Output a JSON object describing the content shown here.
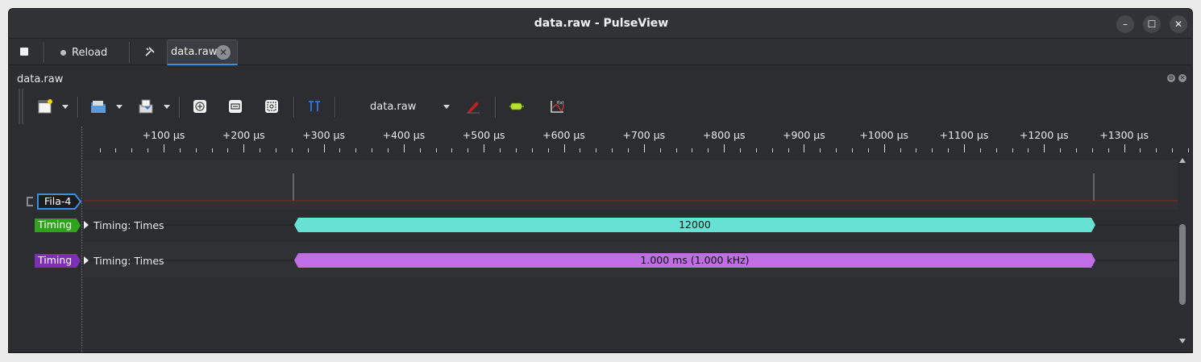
{
  "window": {
    "title": "data.raw - PulseView",
    "controls": [
      "minimize-icon",
      "maximize-icon",
      "close-icon"
    ]
  },
  "tabbar": {
    "reload_label": "Reload",
    "tab_label": "data.raw"
  },
  "dock": {
    "title": "data.raw"
  },
  "toolbar": {
    "device_combo": "data.raw",
    "icons": [
      "new-view-icon",
      "open-file-icon",
      "save-file-icon",
      "zoom-in-icon",
      "zoom-out-icon",
      "zoom-fit-icon",
      "cursors-icon",
      "device-config-icon",
      "decoder-icon",
      "math-channel-icon"
    ]
  },
  "ruler": {
    "ticks": [
      "+100 µs",
      "+200 µs",
      "+300 µs",
      "+400 µs",
      "+500 µs",
      "+600 µs",
      "+700 µs",
      "+800 µs",
      "+900 µs",
      "+1000 µs",
      "+1100 µs",
      "+1200 µs",
      "+1300 µs"
    ]
  },
  "traces": {
    "channel": {
      "label": "Fila-4",
      "color": "#3d8ee0",
      "line_color": "#a11a1a"
    },
    "decoders": [
      {
        "tag": "Timing",
        "tag_color": "#2ea31c",
        "title": "Timing: Times",
        "annotation": "12000",
        "annotation_color": "#66e1d4"
      },
      {
        "tag": "Timing",
        "tag_color": "#7d2fb8",
        "title": "Timing: Times",
        "annotation": "1.000 ms (1.000 kHz)",
        "annotation_color": "#c06de6"
      }
    ]
  }
}
